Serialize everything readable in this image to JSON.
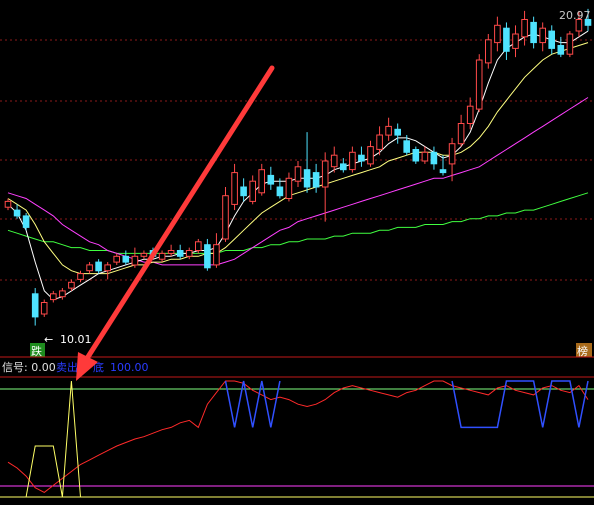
{
  "price_panel": {
    "top_price_label": "20.97",
    "low_price_label": "10.01",
    "bottom_left_tag": "跌",
    "bottom_right_tag": "榜"
  },
  "indicator_panel": {
    "signal_label": "信号: 0.00",
    "sell_label": "卖出",
    "bottom_label": "底",
    "value_label": "100.00"
  },
  "colors": {
    "up": "#ff4a4a",
    "down": "#4fe3ff",
    "ma_fast": "#ffffff",
    "ma_mid": "#ffff80",
    "ma_slow": "#ff40ff",
    "ma_long": "#40ff40",
    "grid": "#8b1a1a",
    "arrow": "#ff3a3a",
    "ind_red": "#ff2a2a",
    "ind_blue": "#3050ff",
    "ind_yellow": "#ffff66",
    "ind_green": "#80ff80",
    "ind_pink": "#ff40ff"
  },
  "chart_data": [
    {
      "type": "candlestick",
      "ylim": [
        9.5,
        21.0
      ],
      "candles": [
        [
          14.1,
          14.3,
          14.4,
          14.0
        ],
        [
          14.0,
          13.8,
          14.2,
          13.7
        ],
        [
          13.8,
          13.4,
          13.9,
          13.3
        ],
        [
          11.1,
          10.3,
          11.3,
          10.0
        ],
        [
          10.4,
          10.8,
          10.9,
          10.3
        ],
        [
          10.9,
          11.1,
          11.2,
          10.8
        ],
        [
          11.0,
          11.2,
          11.3,
          10.9
        ],
        [
          11.3,
          11.5,
          11.6,
          11.2
        ],
        [
          11.6,
          11.8,
          11.9,
          11.5
        ],
        [
          11.9,
          12.1,
          12.2,
          11.8
        ],
        [
          12.2,
          11.9,
          12.3,
          11.8
        ],
        [
          11.9,
          12.1,
          12.2,
          11.6
        ],
        [
          12.2,
          12.4,
          12.5,
          12.1
        ],
        [
          12.4,
          12.2,
          12.6,
          12.1
        ],
        [
          12.1,
          12.4,
          12.7,
          12.0
        ],
        [
          12.4,
          12.5,
          12.6,
          12.3
        ],
        [
          12.6,
          12.4,
          12.7,
          12.3
        ],
        [
          12.3,
          12.5,
          12.6,
          12.2
        ],
        [
          12.5,
          12.6,
          12.8,
          12.4
        ],
        [
          12.6,
          12.4,
          12.8,
          12.3
        ],
        [
          12.4,
          12.6,
          12.7,
          12.3
        ],
        [
          12.6,
          12.9,
          13.0,
          12.5
        ],
        [
          12.8,
          12.0,
          13.0,
          11.9
        ],
        [
          12.1,
          12.8,
          13.2,
          12.0
        ],
        [
          13.0,
          14.5,
          14.8,
          12.9
        ],
        [
          14.2,
          15.3,
          15.6,
          14.0
        ],
        [
          14.8,
          14.5,
          15.1,
          14.3
        ],
        [
          14.3,
          15.0,
          15.2,
          14.2
        ],
        [
          14.6,
          15.4,
          15.6,
          14.5
        ],
        [
          15.2,
          14.9,
          15.5,
          14.7
        ],
        [
          14.8,
          14.5,
          15.1,
          14.4
        ],
        [
          14.4,
          15.1,
          15.3,
          14.3
        ],
        [
          15.0,
          15.5,
          15.7,
          14.8
        ],
        [
          15.4,
          14.8,
          16.7,
          14.6
        ],
        [
          15.3,
          14.8,
          15.6,
          14.6
        ],
        [
          14.8,
          15.7,
          16.0,
          13.6
        ],
        [
          15.5,
          15.9,
          16.2,
          15.3
        ],
        [
          15.6,
          15.4,
          15.8,
          15.3
        ],
        [
          15.4,
          16.0,
          16.2,
          15.3
        ],
        [
          15.9,
          15.7,
          16.2,
          15.5
        ],
        [
          15.6,
          16.2,
          16.4,
          15.5
        ],
        [
          16.1,
          16.6,
          16.9,
          15.9
        ],
        [
          16.6,
          16.9,
          17.2,
          16.4
        ],
        [
          16.8,
          16.6,
          17.0,
          16.3
        ],
        [
          16.4,
          16.0,
          16.6,
          15.9
        ],
        [
          16.1,
          15.7,
          16.2,
          15.6
        ],
        [
          15.7,
          16.0,
          16.2,
          15.6
        ],
        [
          16.0,
          15.6,
          16.2,
          15.4
        ],
        [
          15.4,
          15.3,
          15.9,
          15.2
        ],
        [
          15.6,
          16.3,
          16.5,
          15.0
        ],
        [
          16.3,
          17.0,
          17.3,
          16.2
        ],
        [
          17.0,
          17.6,
          17.9,
          16.8
        ],
        [
          17.5,
          19.2,
          19.4,
          17.4
        ],
        [
          19.1,
          19.9,
          20.1,
          18.9
        ],
        [
          19.8,
          20.4,
          20.7,
          19.5
        ],
        [
          20.3,
          19.5,
          20.5,
          19.2
        ],
        [
          19.6,
          20.1,
          20.4,
          19.3
        ],
        [
          20.0,
          20.6,
          20.9,
          19.7
        ],
        [
          20.5,
          19.8,
          20.7,
          19.6
        ],
        [
          19.8,
          20.3,
          20.5,
          19.5
        ],
        [
          20.2,
          19.6,
          20.4,
          19.4
        ],
        [
          19.7,
          19.4,
          20.0,
          19.3
        ],
        [
          19.4,
          20.1,
          20.2,
          19.3
        ],
        [
          20.2,
          20.6,
          20.9,
          20.0
        ],
        [
          20.6,
          20.4,
          20.97,
          20.2
        ]
      ],
      "ma_fast": [
        14.2,
        13.9,
        13.3,
        12.2,
        11.2,
        10.9,
        11.0,
        11.2,
        11.4,
        11.6,
        11.8,
        11.9,
        12.0,
        12.1,
        12.2,
        12.3,
        12.3,
        12.4,
        12.4,
        12.5,
        12.5,
        12.6,
        12.6,
        12.7,
        13.2,
        13.8,
        14.3,
        14.6,
        14.9,
        15.0,
        15.0,
        15.0,
        15.1,
        15.1,
        15.1,
        15.2,
        15.4,
        15.5,
        15.6,
        15.7,
        15.8,
        16.0,
        16.3,
        16.5,
        16.5,
        16.4,
        16.2,
        16.0,
        15.8,
        15.9,
        16.2,
        16.7,
        17.5,
        18.4,
        19.2,
        19.6,
        19.8,
        20.0,
        20.1,
        20.0,
        19.9,
        19.8,
        19.8,
        20.0,
        20.2
      ],
      "ma_mid": [
        14.4,
        14.2,
        14.0,
        13.5,
        12.9,
        12.5,
        12.1,
        11.9,
        11.8,
        11.8,
        11.8,
        11.8,
        11.9,
        12.0,
        12.1,
        12.1,
        12.2,
        12.2,
        12.3,
        12.3,
        12.4,
        12.4,
        12.5,
        12.5,
        12.7,
        13.0,
        13.3,
        13.6,
        13.9,
        14.1,
        14.3,
        14.5,
        14.6,
        14.7,
        14.8,
        14.9,
        15.0,
        15.1,
        15.2,
        15.3,
        15.4,
        15.5,
        15.7,
        15.8,
        15.9,
        16.0,
        16.0,
        16.0,
        15.9,
        15.9,
        16.0,
        16.2,
        16.5,
        16.9,
        17.4,
        17.8,
        18.2,
        18.6,
        18.9,
        19.2,
        19.4,
        19.5,
        19.6,
        19.7,
        19.8
      ],
      "ma_slow": [
        14.6,
        14.5,
        14.4,
        14.2,
        14.0,
        13.8,
        13.5,
        13.3,
        13.1,
        12.9,
        12.8,
        12.6,
        12.5,
        12.4,
        12.3,
        12.2,
        12.2,
        12.1,
        12.1,
        12.1,
        12.1,
        12.1,
        12.1,
        12.1,
        12.2,
        12.3,
        12.5,
        12.7,
        12.9,
        13.1,
        13.3,
        13.4,
        13.6,
        13.7,
        13.8,
        13.9,
        14.0,
        14.1,
        14.2,
        14.3,
        14.4,
        14.5,
        14.6,
        14.7,
        14.8,
        14.9,
        15.0,
        15.1,
        15.1,
        15.2,
        15.3,
        15.4,
        15.5,
        15.7,
        15.9,
        16.1,
        16.3,
        16.5,
        16.7,
        16.9,
        17.1,
        17.3,
        17.5,
        17.7,
        17.9
      ],
      "ma_long": [
        13.3,
        13.2,
        13.1,
        13.0,
        12.9,
        12.9,
        12.8,
        12.7,
        12.7,
        12.6,
        12.6,
        12.6,
        12.5,
        12.5,
        12.5,
        12.5,
        12.5,
        12.5,
        12.5,
        12.5,
        12.5,
        12.5,
        12.5,
        12.5,
        12.6,
        12.6,
        12.6,
        12.7,
        12.7,
        12.8,
        12.8,
        12.9,
        12.9,
        13.0,
        13.0,
        13.0,
        13.1,
        13.1,
        13.2,
        13.2,
        13.2,
        13.3,
        13.3,
        13.4,
        13.4,
        13.4,
        13.5,
        13.5,
        13.5,
        13.6,
        13.6,
        13.7,
        13.7,
        13.8,
        13.8,
        13.9,
        13.9,
        14.0,
        14.0,
        14.1,
        14.2,
        14.3,
        14.4,
        14.5,
        14.6
      ]
    },
    {
      "type": "line",
      "ylim": [
        0,
        100
      ],
      "series": [
        {
          "color_key": "ind_red",
          "values": [
            30,
            25,
            18,
            8,
            4,
            10,
            16,
            22,
            28,
            32,
            36,
            40,
            44,
            47,
            50,
            52,
            55,
            58,
            60,
            64,
            66,
            60,
            80,
            90,
            100,
            100,
            98,
            92,
            88,
            84,
            86,
            84,
            80,
            78,
            80,
            84,
            90,
            94,
            96,
            94,
            92,
            90,
            88,
            86,
            90,
            92,
            96,
            100,
            100,
            96,
            94,
            92,
            90,
            88,
            94,
            96,
            92,
            90,
            88,
            94,
            96,
            92,
            90,
            96,
            84
          ]
        },
        {
          "color_key": "ind_blue",
          "values": [
            null,
            null,
            null,
            null,
            null,
            null,
            null,
            null,
            null,
            null,
            null,
            null,
            null,
            null,
            null,
            null,
            null,
            null,
            null,
            null,
            null,
            null,
            null,
            null,
            100,
            60,
            100,
            60,
            100,
            60,
            100,
            null,
            null,
            null,
            null,
            null,
            null,
            null,
            null,
            null,
            null,
            null,
            null,
            null,
            null,
            null,
            null,
            null,
            null,
            100,
            60,
            60,
            60,
            60,
            60,
            100,
            100,
            100,
            100,
            60,
            100,
            100,
            100,
            60,
            100
          ]
        },
        {
          "color_key": "ind_yellow",
          "values": [
            0,
            0,
            0,
            44,
            44,
            44,
            0,
            100,
            0,
            0,
            0,
            0,
            0,
            0,
            0,
            0,
            0,
            0,
            0,
            0,
            0,
            0,
            0,
            0,
            0,
            0,
            0,
            0,
            0,
            0,
            0,
            0,
            0,
            0,
            0,
            0,
            0,
            0,
            0,
            0,
            0,
            0,
            0,
            0,
            0,
            0,
            0,
            0,
            0,
            0,
            0,
            0,
            0,
            0,
            0,
            0,
            0,
            0,
            0,
            0,
            0,
            0,
            0,
            0,
            0
          ]
        }
      ]
    }
  ]
}
